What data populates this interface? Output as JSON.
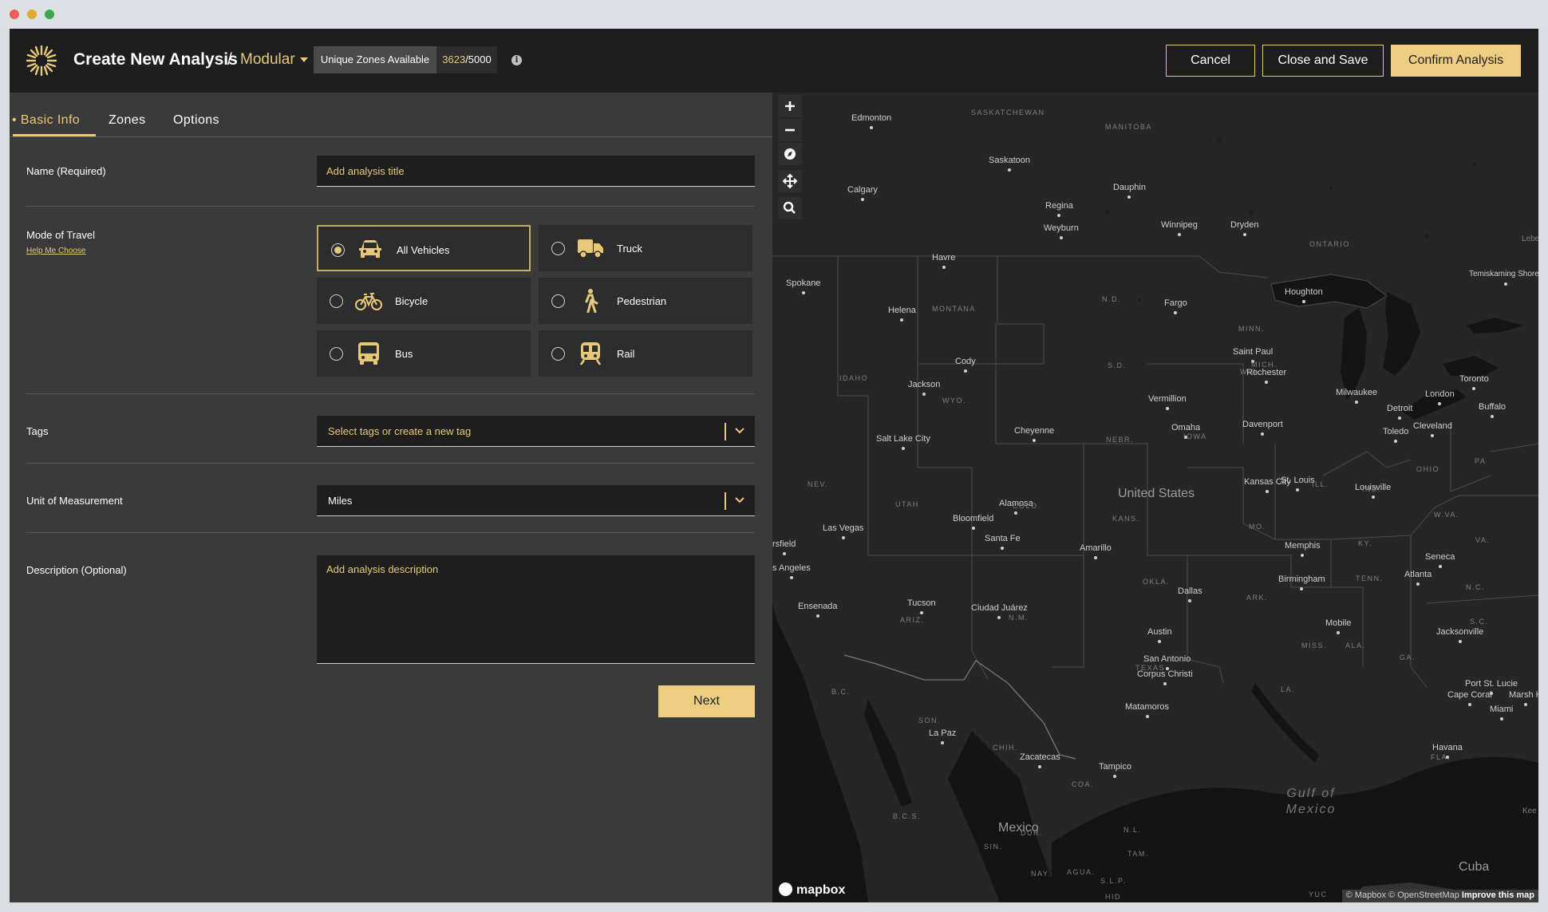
{
  "window": {
    "dot_colors": [
      "#ec5f57",
      "#e0ab2e",
      "#3aa94b"
    ]
  },
  "header": {
    "title": "Create New Analysis",
    "separator": "/",
    "mode": "Modular",
    "zones_label": "Unique Zones Available",
    "zones_used": "3623",
    "zones_total": "/5000",
    "info_icon": "i",
    "cancel": "Cancel",
    "close_save": "Close and Save",
    "confirm": "Confirm Analysis"
  },
  "tabs": [
    {
      "label": "• Basic Info",
      "active": true
    },
    {
      "label": "Zones",
      "active": false
    },
    {
      "label": "Options",
      "active": false
    }
  ],
  "form": {
    "name_label": "Name (Required)",
    "name_placeholder": "Add analysis title",
    "mode_label": "Mode of Travel",
    "help_link": "Help Me Choose",
    "modes": [
      {
        "label": "All Vehicles",
        "icon": "car-icon",
        "selected": true
      },
      {
        "label": "Truck",
        "icon": "truck-icon",
        "selected": false
      },
      {
        "label": "Bicycle",
        "icon": "bicycle-icon",
        "selected": false
      },
      {
        "label": "Pedestrian",
        "icon": "pedestrian-icon",
        "selected": false
      },
      {
        "label": "Bus",
        "icon": "bus-icon",
        "selected": false
      },
      {
        "label": "Rail",
        "icon": "rail-icon",
        "selected": false
      }
    ],
    "tags_label": "Tags",
    "tags_placeholder": "Select tags or create a new tag",
    "unit_label": "Unit of Measurement",
    "unit_value": "Miles",
    "desc_label": "Description (Optional)",
    "desc_placeholder": "Add analysis description",
    "next": "Next"
  },
  "colors": {
    "accent": "#e8c97a",
    "header_bg": "#1e1e1e",
    "panel_bg": "#3a3a3a",
    "map_bg": "#262626"
  },
  "map": {
    "controls": [
      "zoom-in-icon",
      "zoom-out-icon",
      "compass-icon",
      "pan-icon",
      "search-icon"
    ],
    "cities": [
      "Edmonton",
      "Saskatoon",
      "Calgary",
      "Dauphin",
      "Regina",
      "Weyburn",
      "Winnipeg",
      "Dryden",
      "Havre",
      "Spokane",
      "Fargo",
      "Houghton",
      "Helena",
      "Temiskaming Shores",
      "Saint Paul",
      "Cody",
      "Rochester",
      "Jackson",
      "Milwaukee",
      "Toronto",
      "Vermillion",
      "London",
      "Detroit",
      "Buffalo",
      "Omaha",
      "Davenport",
      "Cleveland",
      "Toledo",
      "Cheyenne",
      "Salt Lake City",
      "Kansas City",
      "St. Louis",
      "Louisville",
      "Alamosa",
      "Bloomfield",
      "Las Vegas",
      "rsfield",
      "Santa Fe",
      "Amarillo",
      "Memphis",
      "Seneca",
      "s Angeles",
      "Birmingham",
      "Atlanta",
      "Dallas",
      "Tucson",
      "Ensenada",
      "Ciudad Juárez",
      "Mobile",
      "Jacksonville",
      "Austin",
      "San Antonio",
      "Corpus Christi",
      "Port St. Lucie",
      "Cape Coral",
      "Marsh H",
      "Miami",
      "Matamoros",
      "La Paz",
      "Zacatecas",
      "Tampico",
      "Havana"
    ],
    "regions": [
      "SASKATCHEWAN",
      "MANITOBA",
      "ONTARIO",
      "MONTANA",
      "N.D.",
      "MINN.",
      "IDAHO",
      "WYO.",
      "S.D.",
      "WIS.",
      "MICH.",
      "NEBR.",
      "IOWA",
      "NEV.",
      "UTAH",
      "COLO.",
      "KANS.",
      "MO.",
      "ILL.",
      "IND.",
      "OHIO",
      "PA",
      "W.VA.",
      "KY.",
      "VA.",
      "ARIZ.",
      "N.M.",
      "OKLA.",
      "TENN.",
      "N.C.",
      "ARK.",
      "S.C.",
      "MISS.",
      "ALA.",
      "GA.",
      "TEXAS",
      "LA.",
      "B.C.",
      "SON.",
      "CHIH.",
      "FLA.",
      "COA.",
      "B.C.S.",
      "DUR.",
      "N.L.",
      "SIN.",
      "TAM.",
      "S.L.P.",
      "NAY.",
      "AGUA.",
      "HID",
      "YUC",
      "Lebel",
      "Kee"
    ],
    "country_us": "United States",
    "country_mx": "Mexico",
    "country_cu": "Cuba",
    "gulf": "Gulf of Mexico",
    "logo": "mapbox",
    "attr_mapbox": "© Mapbox",
    "attr_osm": "© OpenStreetMap",
    "attr_improve": "Improve this map"
  }
}
